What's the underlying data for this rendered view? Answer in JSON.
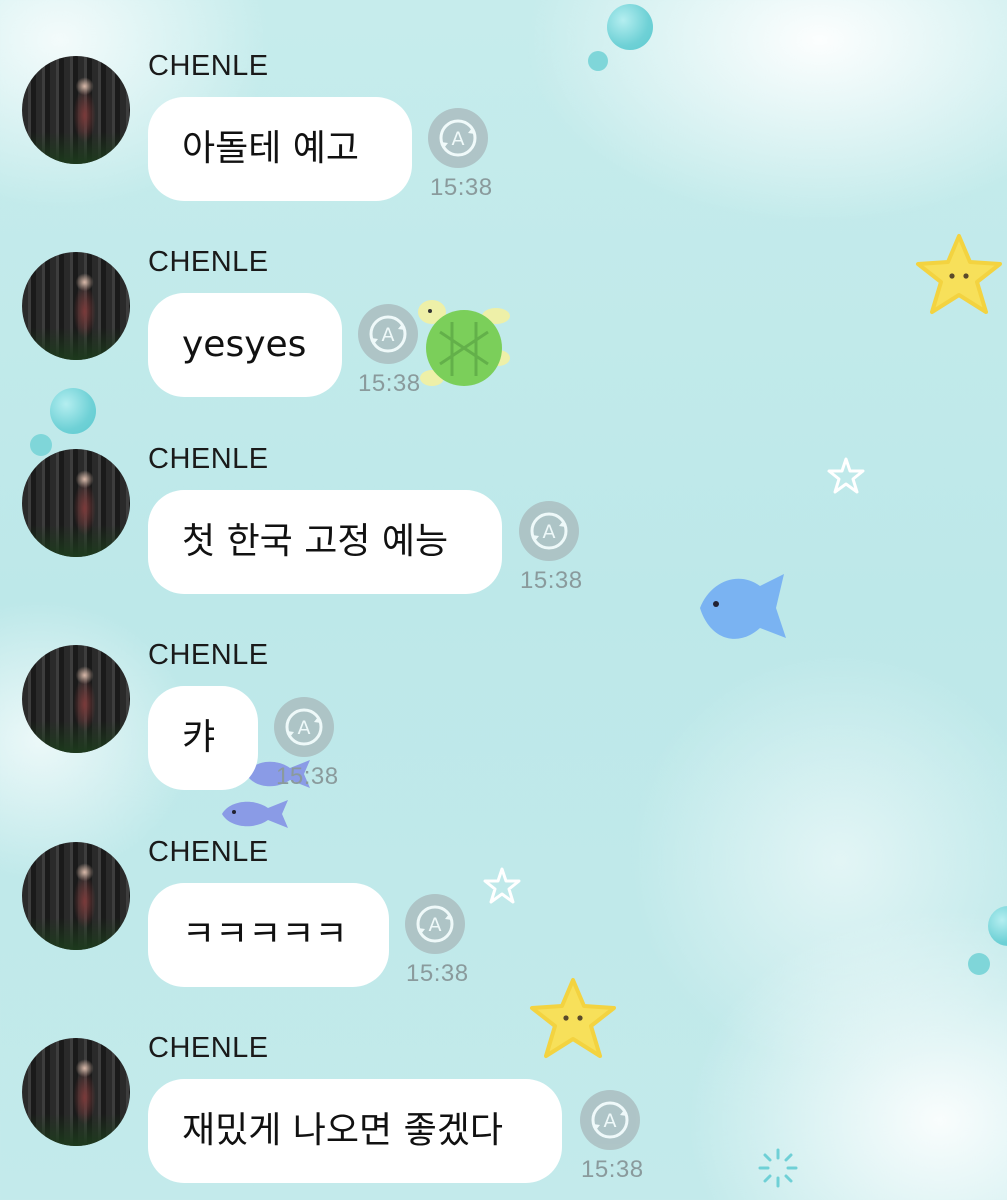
{
  "chat": {
    "messages": [
      {
        "sender": "CHENLE",
        "text": "아돌테 예고",
        "time": "15:38"
      },
      {
        "sender": "CHENLE",
        "text": "yesyes",
        "time": "15:38"
      },
      {
        "sender": "CHENLE",
        "text": "첫 한국 고정 예능",
        "time": "15:38"
      },
      {
        "sender": "CHENLE",
        "text": "캬",
        "time": "15:38"
      },
      {
        "sender": "CHENLE",
        "text": "ㅋㅋㅋㅋㅋ",
        "time": "15:38"
      },
      {
        "sender": "CHENLE",
        "text": "재밌게 나오면 좋겠다",
        "time": "15:38"
      }
    ],
    "translate_icon": "translate-icon",
    "colors": {
      "background": "#bde8e9",
      "bubble": "#ffffff",
      "timestamp": "#8a9a9c",
      "icon": "#a8b8bb"
    }
  }
}
